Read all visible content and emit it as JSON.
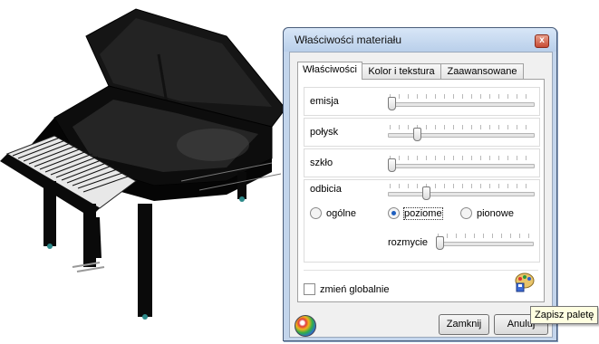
{
  "dialog": {
    "title": "Właściwości materiału",
    "close_glyph": "x",
    "tabs": [
      {
        "label": "Właściwości",
        "active": true
      },
      {
        "label": "Kolor i tekstura",
        "active": false
      },
      {
        "label": "Zaawansowane",
        "active": false
      }
    ],
    "sliders": {
      "emisja": {
        "label": "emisja",
        "value": 0.0
      },
      "polysk": {
        "label": "połysk",
        "value": 0.18
      },
      "szklo": {
        "label": "szkło",
        "value": 0.0
      },
      "odbicia": {
        "label": "odbicia",
        "value": 0.25
      },
      "rozmycie": {
        "label": "rozmycie",
        "value": 0.0
      }
    },
    "reflection_modes": [
      {
        "label": "ogólne",
        "selected": false
      },
      {
        "label": "poziome",
        "selected": true
      },
      {
        "label": "pionowe",
        "selected": false
      }
    ],
    "global_checkbox": {
      "label": "zmień globalnie",
      "checked": false
    },
    "buttons": {
      "close": "Zamknij",
      "cancel": "Anuluj"
    },
    "tooltip": "Zapisz paletę"
  },
  "icons": [
    "piano-illustration",
    "palette-icon",
    "color-globe-icon",
    "close-icon"
  ]
}
